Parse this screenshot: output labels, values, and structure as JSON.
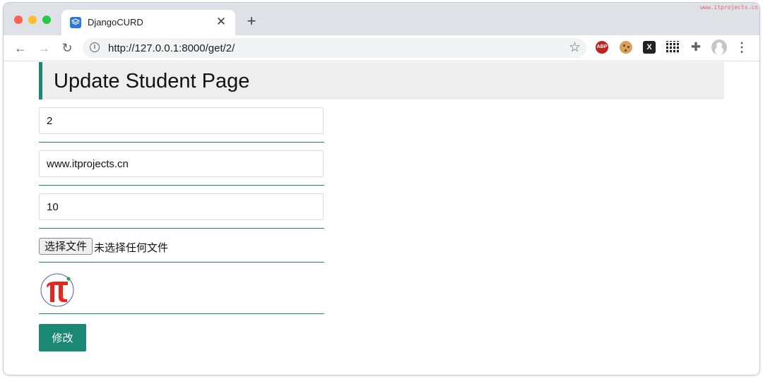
{
  "browser": {
    "tab_title": "DjangoCURD",
    "url": "http://127.0.0.1:8000/get/2/",
    "watermark": "www.itprojects.cn",
    "extensions": {
      "abp_label": "ABP",
      "x_label": "X"
    }
  },
  "page": {
    "title": "Update Student Page",
    "fields": {
      "id_value": "2",
      "name_value": "www.itprojects.cn",
      "age_value": "10"
    },
    "file_input": {
      "button_label": "选择文件",
      "status": "未选择任何文件"
    },
    "avatar_icon": "pi-logo-icon",
    "submit_label": "修改"
  },
  "colors": {
    "accent": "#1a8872",
    "header_bg": "#eeeeee",
    "pi_red": "#e8261f"
  }
}
